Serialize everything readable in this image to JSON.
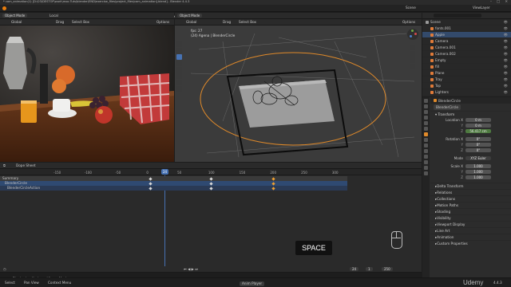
{
  "title": "* cam_animation(1) [D:\\03\\DESTOP\\work\\moo Tuts\\blender\\END\\exercise_files\\project_files\\cam_animation].blend] - Blender 4.4.3",
  "menu": [
    "File",
    "Edit",
    "Render",
    "Window",
    "Help"
  ],
  "workspaces": [
    "Layout",
    "Modeling",
    "Sculpting",
    "UV Editing",
    "Texture Paint",
    "Shading",
    "Animation",
    "Rendering",
    "Compositing",
    "Geometry Nodes",
    "Scripting"
  ],
  "active_workspace": "Animation",
  "scene": "Scene",
  "view_layer": "ViewLayer",
  "left_view": {
    "mode": "Object Mode",
    "view": "View",
    "orientation": "Global",
    "drag": "Drag",
    "select": "Select Box",
    "options": "Options",
    "transform": "Local"
  },
  "right_view": {
    "mode": "Object Mode",
    "menus": [
      "View",
      "Select",
      "Add",
      "Object"
    ],
    "orientation": "Global",
    "drag": "Drag",
    "select": "Select Box",
    "options": "Options",
    "info1": "fps: 27",
    "info2": "(24) Agena | BlenderCircle"
  },
  "outliner": {
    "search": "",
    "items": [
      {
        "name": "Scene",
        "color": "#9a9a9a"
      },
      {
        "name": "fonts.001",
        "color": "#e07b39"
      },
      {
        "name": "Apple",
        "color": "#e07b39",
        "sel": true
      },
      {
        "name": "Camera",
        "color": "#e07b39"
      },
      {
        "name": "Camera.001",
        "color": "#e07b39"
      },
      {
        "name": "Camera.002",
        "color": "#e07b39"
      },
      {
        "name": "Empty",
        "color": "#e07b39"
      },
      {
        "name": "fill",
        "color": "#e07b39"
      },
      {
        "name": "Plane",
        "color": "#e07b39"
      },
      {
        "name": "Tray",
        "color": "#e07b39"
      },
      {
        "name": "Top",
        "color": "#e07b39"
      },
      {
        "name": "Lighters",
        "color": "#e07b39"
      }
    ]
  },
  "props": {
    "object": "BlenderCircle",
    "panel": "BlenderCircle",
    "transform": "Transform",
    "location_label": "Location X",
    "location": [
      "0 m",
      "0 m",
      "56.417 cm"
    ],
    "rotation_label": "Rotation X",
    "rotation": [
      "0°",
      "0°",
      "0°"
    ],
    "mode_label": "Mode",
    "mode": "XYZ Euler",
    "scale_label": "Scale X",
    "scale": [
      "1.000",
      "1.000",
      "1.000"
    ],
    "sections": [
      "Delta Transform",
      "Relations",
      "Collections",
      "Motion Paths",
      "Shading",
      "Visibility",
      "Viewport Display",
      "Line Art",
      "Animation",
      "Custom Properties"
    ]
  },
  "dopesheet": {
    "editor": "Dope Sheet",
    "menus": [
      "View",
      "Select",
      "Marker",
      "Channel",
      "Key"
    ],
    "mode": "Dope Sheet",
    "ticks": [
      "-150",
      "-100",
      "-50",
      "0",
      "50",
      "100",
      "150",
      "200",
      "250",
      "300"
    ],
    "current_frame": "24",
    "channels": [
      "Summary",
      "BlenderCircle",
      "BlenderCircleAction"
    ],
    "overlay_key": "SPACE"
  },
  "timeline": {
    "items": [
      "Playback",
      "Keying",
      "View",
      "Marker"
    ],
    "start": "1",
    "end": "250",
    "frame": "24"
  },
  "status": {
    "left": [
      "Select",
      "Pan View",
      "Context Menu"
    ],
    "center": "Anim Player",
    "right": "4.4.3"
  },
  "watermark": "Udemy"
}
